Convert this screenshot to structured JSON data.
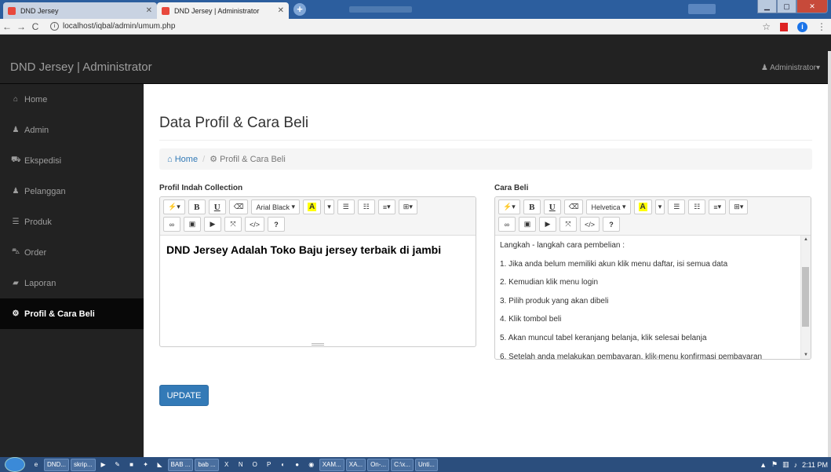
{
  "browser": {
    "tabs": [
      {
        "title": "DND Jersey",
        "active": false
      },
      {
        "title": "DND Jersey | Administrator",
        "active": true
      }
    ],
    "url": "localhost/iqbal/admin/umum.php"
  },
  "navbar": {
    "brand": "DND Jersey | Administrator",
    "user": "Administrator"
  },
  "sidebar": {
    "items": [
      {
        "icon": "home-icon",
        "label": "Home"
      },
      {
        "icon": "user-icon",
        "label": "Admin"
      },
      {
        "icon": "car-icon",
        "label": "Ekspedisi"
      },
      {
        "icon": "users-icon",
        "label": "Pelanggan"
      },
      {
        "icon": "list-icon",
        "label": "Produk"
      },
      {
        "icon": "cart-icon",
        "label": "Order"
      },
      {
        "icon": "book-icon",
        "label": "Laporan"
      },
      {
        "icon": "cogs-icon",
        "label": "Profil & Cara Beli"
      }
    ]
  },
  "page": {
    "title": "Data Profil & Cara Beli",
    "breadcrumb": {
      "home": "Home",
      "current": "Profil & Cara Beli"
    }
  },
  "editor_profil": {
    "label": "Profil Indah Collection",
    "font": "Arial Black",
    "content": "DND Jersey Adalah Toko Baju jersey terbaik di jambi"
  },
  "editor_cara": {
    "label": "Cara Beli",
    "font": "Helvetica",
    "content": [
      "Langkah - langkah cara pembelian :",
      "1. Jika anda belum memiliki akun klik menu daftar, isi semua data",
      "2. Kemudian klik menu login",
      "3. Pilih produk yang akan dibeli",
      "4. Klik tombol beli",
      "5. Akan muncul tabel keranjang belanja, klik selesai belanja",
      "6. Setelah anda melakukan pembayaran, klik menu konfirmasi pembayaran"
    ]
  },
  "toolbar": {
    "bold": "B",
    "underline": "U",
    "highlight": "A",
    "help": "?",
    "code": "</>"
  },
  "update_label": "UPDATE",
  "taskbar": {
    "items": [
      "DND...",
      "skrip...",
      "BAB ...",
      "bab ...",
      "XAM...",
      "XA...",
      "On-...",
      "C:\\x...",
      "Unti..."
    ],
    "clock": "2:11 PM"
  }
}
